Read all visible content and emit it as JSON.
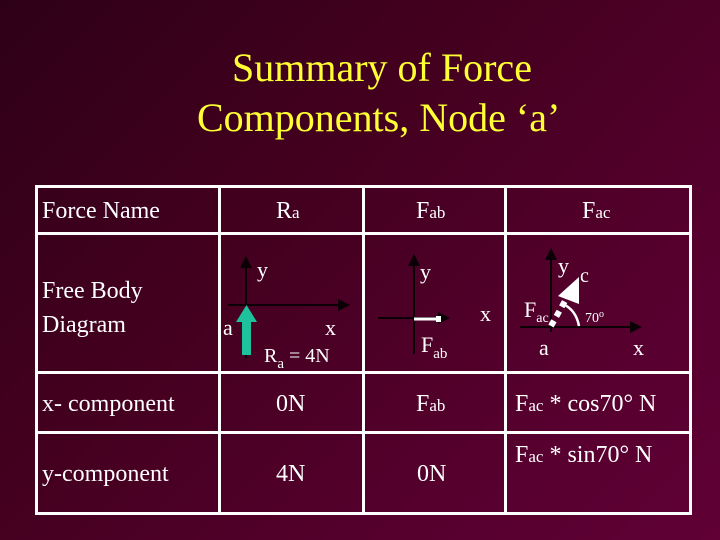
{
  "title": {
    "line1": "Summary of Force",
    "line2": "Components, Node ‘a’"
  },
  "table": {
    "row_labels": {
      "force_name": "Force Name",
      "fbd_line1": "Free Body",
      "fbd_line2": "Diagram",
      "x_component": "x- component",
      "y_component": "y-component"
    },
    "columns": [
      {
        "name_main": "R",
        "name_sub": "a",
        "x_component": "0N",
        "y_component": "4N"
      },
      {
        "name_main": "F",
        "name_sub": "ab",
        "x_component_main": "F",
        "x_component_sub": "ab",
        "y_component": "0N"
      },
      {
        "name_main": "F",
        "name_sub": "ac",
        "x_component_main": "F",
        "x_component_sub": "ac",
        "x_component_rest": " * cos70° N",
        "y_component_main": "F",
        "y_component_sub": "ac",
        "y_component_rest": " * sin70° N"
      }
    ]
  },
  "diagrams": {
    "ra": {
      "y_label": "y",
      "x_label": "x",
      "node_label": "a",
      "force_main": "R",
      "force_sub": "a",
      "force_value": " = 4N",
      "arrow_color": "#1fc09c",
      "direction": "up"
    },
    "fab": {
      "y_label": "y",
      "x_label": "x",
      "force_main": "F",
      "force_sub": "ab",
      "arrow_color": "#ffffff",
      "direction": "right"
    },
    "fac": {
      "y_label": "y",
      "x_label": "x",
      "node_label": "a",
      "end_label": "c",
      "force_main": "F",
      "force_sub": "ac",
      "angle_label": "70",
      "angle_unit": "o",
      "angle_deg": 70,
      "arrow_color": "#ffffff"
    }
  },
  "colors": {
    "title": "#ffff33",
    "text": "#ffffff",
    "grid": "#ffffff",
    "axis": "#0a0005"
  }
}
